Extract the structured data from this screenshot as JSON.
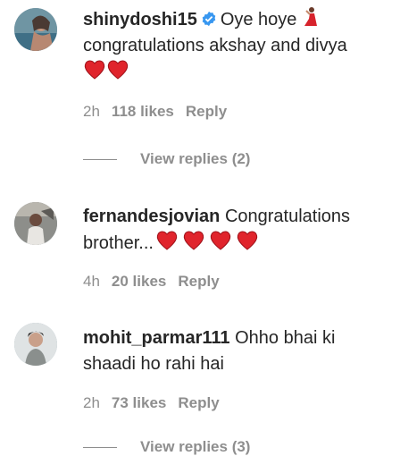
{
  "comments": [
    {
      "username": "shinydoshi15",
      "verified": true,
      "text_parts": [
        "Oye hoye",
        "congratulations akshay and divya"
      ],
      "time": "2h",
      "likes": "118 likes",
      "reply": "Reply",
      "view_replies": "View replies (2)"
    },
    {
      "username": "fernandesjovian",
      "verified": false,
      "text_parts": [
        "Congratulations",
        "brother..."
      ],
      "time": "4h",
      "likes": "20 likes",
      "reply": "Reply"
    },
    {
      "username": "mohit_parmar111",
      "verified": false,
      "text_parts": [
        "Ohho bhai ki",
        "shaadi ho rahi hai"
      ],
      "time": "2h",
      "likes": "73 likes",
      "reply": "Reply",
      "view_replies": "View replies (3)"
    }
  ],
  "icons": {
    "verified": "verified-badge-icon",
    "heart": "red-heart-emoji",
    "dancer": "dancer-emoji"
  },
  "colors": {
    "text": "#262626",
    "muted": "#8e8e8e",
    "verified": "#3897f0",
    "heart": "#e0242c"
  }
}
